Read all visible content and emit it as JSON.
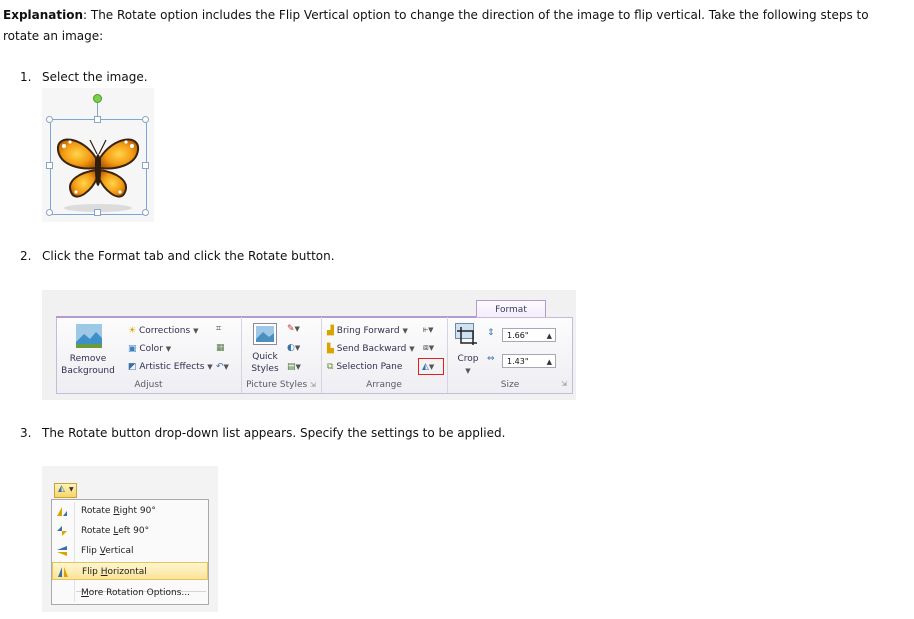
{
  "explanation": {
    "label": "Explanation",
    "text": ": The Rotate option includes the Flip Vertical option to change the direction of the image to flip vertical. Take the following steps to rotate an image:"
  },
  "steps": [
    {
      "number": "1.",
      "text": "Select the image."
    },
    {
      "number": "2.",
      "text": "Click the Format tab and click the Rotate button."
    },
    {
      "number": "3.",
      "text": "The Rotate button drop-down list appears. Specify the settings to be applied."
    }
  ],
  "ribbon": {
    "tab": "Format",
    "remove_background": [
      "Remove",
      "Background"
    ],
    "corrections": "Corrections",
    "color": "Color",
    "artistic_effects": "Artistic Effects",
    "quick_styles": [
      "Quick",
      "Styles"
    ],
    "bring_forward": "Bring Forward",
    "send_backward": "Send Backward",
    "selection_pane": "Selection Pane",
    "crop": "Crop",
    "height": "1.66\"",
    "width": "1.43\"",
    "groups": {
      "adjust": "Adjust",
      "picture_styles": "Picture Styles",
      "arrange": "Arrange",
      "size": "Size"
    }
  },
  "rotate_menu": {
    "items": [
      {
        "prefix": "Rotate ",
        "key": "R",
        "suffix": "ight 90°"
      },
      {
        "prefix": "Rotate ",
        "key": "L",
        "suffix": "eft 90°"
      },
      {
        "prefix": "Flip ",
        "key": "V",
        "suffix": "ertical"
      },
      {
        "prefix": "Flip ",
        "key": "H",
        "suffix": "orizontal"
      },
      {
        "prefix": "",
        "key": "M",
        "suffix": "ore Rotation Options..."
      }
    ],
    "highlighted_index": 3
  },
  "colors": {
    "accent_purple": "#b39ad2",
    "highlight_red": "#e02020",
    "menu_highlight": "#fbe39a"
  }
}
